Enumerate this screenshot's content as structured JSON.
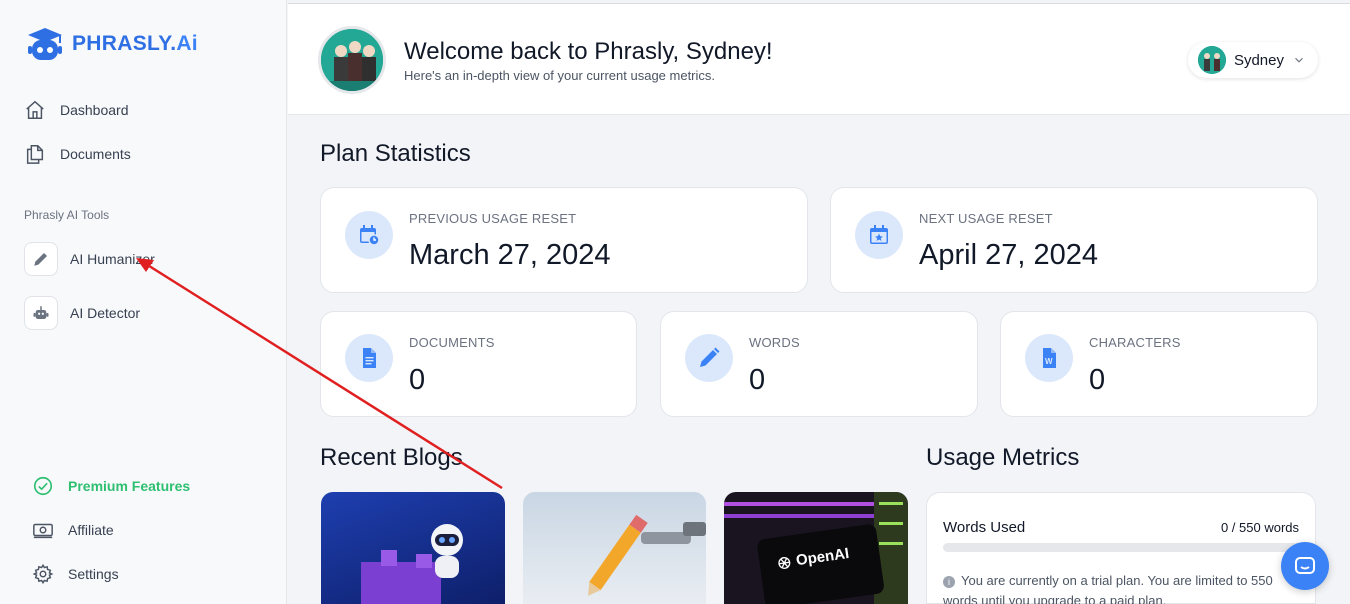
{
  "brand": {
    "name": "PHRASLY.",
    "suffix": "Ai",
    "color": "#2f6fe4"
  },
  "sidebar": {
    "nav": [
      {
        "label": "Dashboard",
        "icon": "home-icon"
      },
      {
        "label": "Documents",
        "icon": "documents-icon"
      }
    ],
    "section_label": "Phrasly AI Tools",
    "tools": [
      {
        "label": "AI Humanizer",
        "icon": "pencil-icon"
      },
      {
        "label": "AI Detector",
        "icon": "robot-icon"
      }
    ],
    "bottom": [
      {
        "label": "Premium Features",
        "icon": "check-circle-icon",
        "color": "#2fbf71"
      },
      {
        "label": "Affiliate",
        "icon": "money-icon"
      },
      {
        "label": "Settings",
        "icon": "gear-icon"
      }
    ]
  },
  "header": {
    "title": "Welcome back to Phrasly, Sydney!",
    "subtitle": "Here's an in-depth view of your current usage metrics.",
    "user_name": "Sydney"
  },
  "plan": {
    "title": "Plan Statistics",
    "previous_reset": {
      "label": "PREVIOUS USAGE RESET",
      "value": "March 27, 2024",
      "icon": "calendar-clock-icon"
    },
    "next_reset": {
      "label": "NEXT USAGE RESET",
      "value": "April 27, 2024",
      "icon": "calendar-star-icon"
    },
    "documents": {
      "label": "DOCUMENTS",
      "value": "0",
      "icon": "document-icon"
    },
    "words": {
      "label": "WORDS",
      "value": "0",
      "icon": "pencil-icon"
    },
    "characters": {
      "label": "CHARACTERS",
      "value": "0",
      "icon": "word-file-icon"
    }
  },
  "blogs": {
    "title": "Recent Blogs",
    "logo_text": "OpenAI"
  },
  "metrics": {
    "title": "Usage Metrics",
    "words_used_label": "Words Used",
    "words_count": "0 / 550 words",
    "progress": 0,
    "info": "You are currently on a trial plan. You are limited to 550 words until you upgrade to a paid plan."
  },
  "colors": {
    "accent": "#3b82f6",
    "annotation_arrow": "#e02020"
  }
}
